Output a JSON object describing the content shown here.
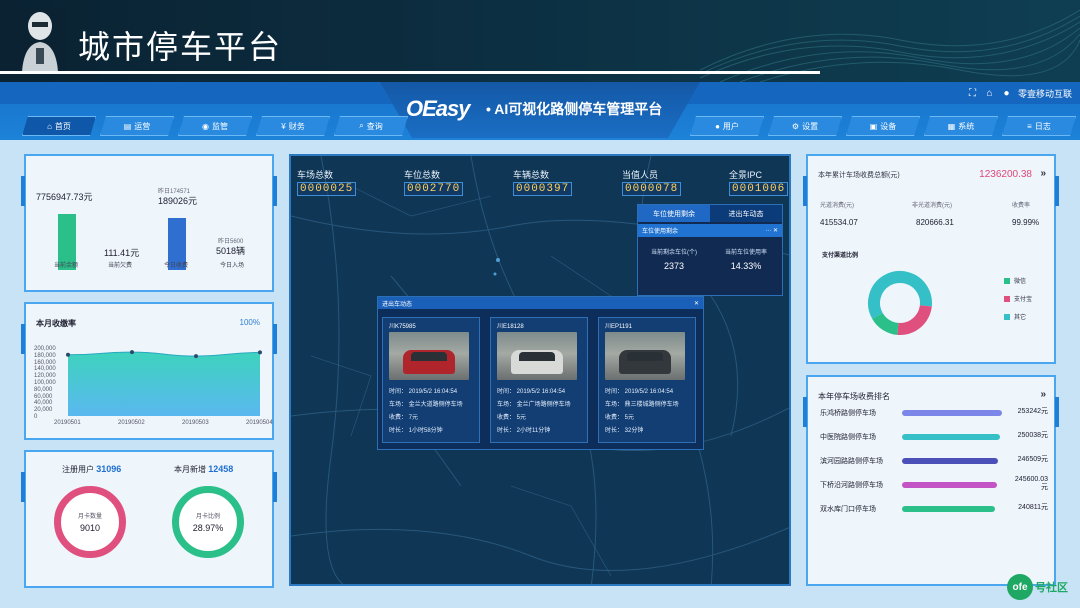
{
  "slide": {
    "title": "城市停车平台"
  },
  "app": {
    "logo": "OEasy",
    "title": "• AI可视化路侧停车管理平台",
    "top_right": {
      "user": "零壹移动互联",
      "icons": [
        "fullscreen-icon",
        "home-icon",
        "user-icon"
      ]
    }
  },
  "nav_left": [
    {
      "label": "首页",
      "icon": "home-icon",
      "active": true
    },
    {
      "label": "运营",
      "icon": "chart-icon",
      "active": false
    },
    {
      "label": "监管",
      "icon": "monitor-icon",
      "active": false
    },
    {
      "label": "财务",
      "icon": "money-icon",
      "active": false
    },
    {
      "label": "查询",
      "icon": "search-icon",
      "active": false
    }
  ],
  "nav_right": [
    {
      "label": "用户",
      "icon": "user-icon"
    },
    {
      "label": "设置",
      "icon": "gear-icon"
    },
    {
      "label": "设备",
      "icon": "device-icon"
    },
    {
      "label": "系统",
      "icon": "system-icon"
    },
    {
      "label": "日志",
      "icon": "log-icon"
    }
  ],
  "bars_panel": {
    "items": [
      {
        "value": "7756947.73元",
        "label": "当前余额",
        "color": "#2bbf8a",
        "level": 0.88
      },
      {
        "value": "111.41元",
        "label": "当前欠费",
        "color": "#2bbf8a",
        "level": 0.0
      },
      {
        "value": "189026元",
        "prev": "昨日174571",
        "label": "今日收费",
        "color": "#2f6fcf",
        "level": 0.75
      },
      {
        "value": "5018辆",
        "prev": "昨日5600",
        "label": "今日入场",
        "color": "#2f6fcf",
        "level": 0.0
      }
    ]
  },
  "area_panel": {
    "title": "本月收缴率",
    "percent": "100%",
    "y_ticks": [
      "200,000",
      "180,000",
      "160,000",
      "140,000",
      "120,000",
      "100,000",
      "80,000",
      "60,000",
      "40,000",
      "20,000",
      "0"
    ],
    "x_ticks": [
      "20190501",
      "20190502",
      "20190503",
      "20190504"
    ]
  },
  "chart_data": {
    "type": "area",
    "title": "本月收缴率",
    "categories": [
      "20190501",
      "20190502",
      "20190503",
      "20190504"
    ],
    "x": [
      "20190501",
      "20190502",
      "20190503",
      "20190504"
    ],
    "values": [
      180000,
      188000,
      176000,
      187000
    ],
    "ylim": [
      0,
      200000
    ],
    "grid": false
  },
  "rings_panel": {
    "registered_label": "注册用户",
    "registered_value": "31096",
    "month_new_label": "本月新增",
    "month_new_value": "12458",
    "ring1": {
      "label": "月卡数量",
      "value": "9010",
      "color": "#e0507e"
    },
    "ring2": {
      "label": "月卡比例",
      "value": "28.97%",
      "color": "#2bbf8a"
    }
  },
  "map": {
    "stats": [
      {
        "label": "车场总数",
        "value": "0000025"
      },
      {
        "label": "车位总数",
        "value": "0002770"
      },
      {
        "label": "车辆总数",
        "value": "0000397"
      },
      {
        "label": "当值人员",
        "value": "0000078"
      },
      {
        "label": "全景IPC",
        "value": "0001006"
      }
    ],
    "usage": {
      "tab1": "车位使用剩余",
      "tab2": "进出车动态",
      "bar": "车位使用剩余",
      "cell1_label": "当前剩余车位(个)",
      "cell1_value": "2373",
      "cell2_label": "当前车位使用率",
      "cell2_value": "14.33%"
    },
    "dynamics": {
      "title": "进出车动态",
      "cards": [
        {
          "plate": "川K75985",
          "time": "时间：  2019/5/2 16:04:54",
          "lot": "车场：  金兰大道路侧停车场",
          "fee": "收费：  7元",
          "duration": "时长：  1小时58分钟",
          "car_color": "#b0242c"
        },
        {
          "plate": "川E18128",
          "time": "时间：  2019/5/2 16:04:54",
          "lot": "车场：  金兰广场路侧停车场",
          "fee": "收费：  5元",
          "duration": "时长：  2小时11分钟",
          "car_color": "#d8dad7"
        },
        {
          "plate": "川EP1191",
          "time": "时间：  2019/5/2 16:04:54",
          "lot": "车场：  鼎三楼城路侧停车场",
          "fee": "收费：  5元",
          "duration": "时长：  32分钟",
          "car_color": "#33383c"
        }
      ]
    }
  },
  "fees_panel": {
    "head": "本年累计车场收费总额(元)",
    "total": "1236200.38",
    "cols": [
      {
        "label": "光道消费(元)",
        "value": "415534.07"
      },
      {
        "label": "非光道消费(元)",
        "value": "820666.31"
      },
      {
        "label": "收费率",
        "value": "99.99%"
      }
    ],
    "chart_title": "支付渠道比例",
    "legend": [
      {
        "label": "微信",
        "color": "#2bbf8a"
      },
      {
        "label": "支付宝",
        "color": "#e0507e"
      },
      {
        "label": "其它",
        "color": "#35c0c8"
      }
    ]
  },
  "rank_panel": {
    "title": "本年停车场收费排名",
    "rows": [
      {
        "name": "乐鸿桥路侧停车场",
        "value": "253242元",
        "color": "#7c86e8",
        "fill": 1.0
      },
      {
        "name": "中医院路侧停车场",
        "value": "250038元",
        "color": "#35c0c8",
        "fill": 0.98
      },
      {
        "name": "滨河园路路侧停车场",
        "value": "246509元",
        "color": "#4b4fb8",
        "fill": 0.96
      },
      {
        "name": "下桥沿河路侧停车场",
        "value": "245600.03元",
        "color": "#c454c6",
        "fill": 0.95
      },
      {
        "name": "双水库门口停车场",
        "value": "240811元",
        "color": "#2bbf8a",
        "fill": 0.93
      }
    ]
  },
  "watermark": {
    "logo": "ofe",
    "text": "号社区"
  }
}
